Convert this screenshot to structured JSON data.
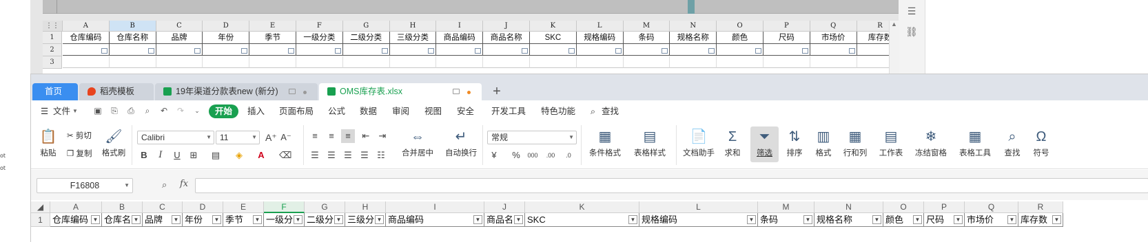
{
  "left_strip": {
    "lines": [
      "ot",
      "ot"
    ]
  },
  "bg_sheet": {
    "columns": [
      "A",
      "B",
      "C",
      "D",
      "E",
      "F",
      "G",
      "H",
      "I",
      "J",
      "K",
      "L",
      "M",
      "N",
      "O",
      "P",
      "Q",
      "R"
    ],
    "row_numbers": [
      "1",
      "2",
      "3"
    ],
    "headers": [
      "仓库编码",
      "仓库名称",
      "品牌",
      "年份",
      "季节",
      "一级分类",
      "二级分类",
      "三级分类",
      "商品编码",
      "商品名称",
      "SKC",
      "规格编码",
      "条码",
      "规格名称",
      "颜色",
      "尺码",
      "市场价",
      "库存数"
    ]
  },
  "tabs": {
    "home": "首页",
    "docer": "稻壳模板",
    "file1": "19年渠道分款表new (新分)",
    "file2": "OMS库存表.xlsx"
  },
  "menu": {
    "file": "文件",
    "start": "开始",
    "insert": "插入",
    "layout": "页面布局",
    "formula": "公式",
    "data": "数据",
    "review": "审阅",
    "view": "视图",
    "security": "安全",
    "devtools": "开发工具",
    "features": "特色功能",
    "search": "查找"
  },
  "ribbon": {
    "paste": "粘贴",
    "cut": "剪切",
    "copy": "复制",
    "format_painter": "格式刷",
    "font_name": "Calibri",
    "font_size": "11",
    "merge_center": "合并居中",
    "wrap_text": "自动换行",
    "number_format": "常规",
    "conditional_format": "条件格式",
    "table_style": "表格样式",
    "doc_helper": "文档助手",
    "sum": "求和",
    "filter": "筛选",
    "sort": "排序",
    "format": "格式",
    "row_col": "行和列",
    "worksheet": "工作表",
    "freeze": "冻结窗格",
    "table_tools": "表格工具",
    "find": "查找",
    "symbol": "符号"
  },
  "formula_bar": {
    "cell_ref": "F16808",
    "fx": "fx",
    "value": ""
  },
  "sheet": {
    "columns": [
      "A",
      "B",
      "C",
      "D",
      "E",
      "F",
      "G",
      "H",
      "I",
      "J",
      "K",
      "L",
      "M",
      "N",
      "O",
      "P",
      "Q",
      "R"
    ],
    "selected_column": "F",
    "row_numbers": [
      "1"
    ],
    "headers": [
      "仓库编码",
      "仓库名",
      "品牌",
      "年份",
      "季节",
      "一级分",
      "二级分",
      "三级分",
      "商品编码",
      "商品名",
      "SKC",
      "规格编码",
      "条码",
      "规格名称",
      "颜色",
      "尺码",
      "市场价",
      "库存数"
    ]
  },
  "colors": {
    "accent_green": "#19a050",
    "home_tab_blue": "#3a8ef0",
    "docer_red": "#e8431d"
  }
}
